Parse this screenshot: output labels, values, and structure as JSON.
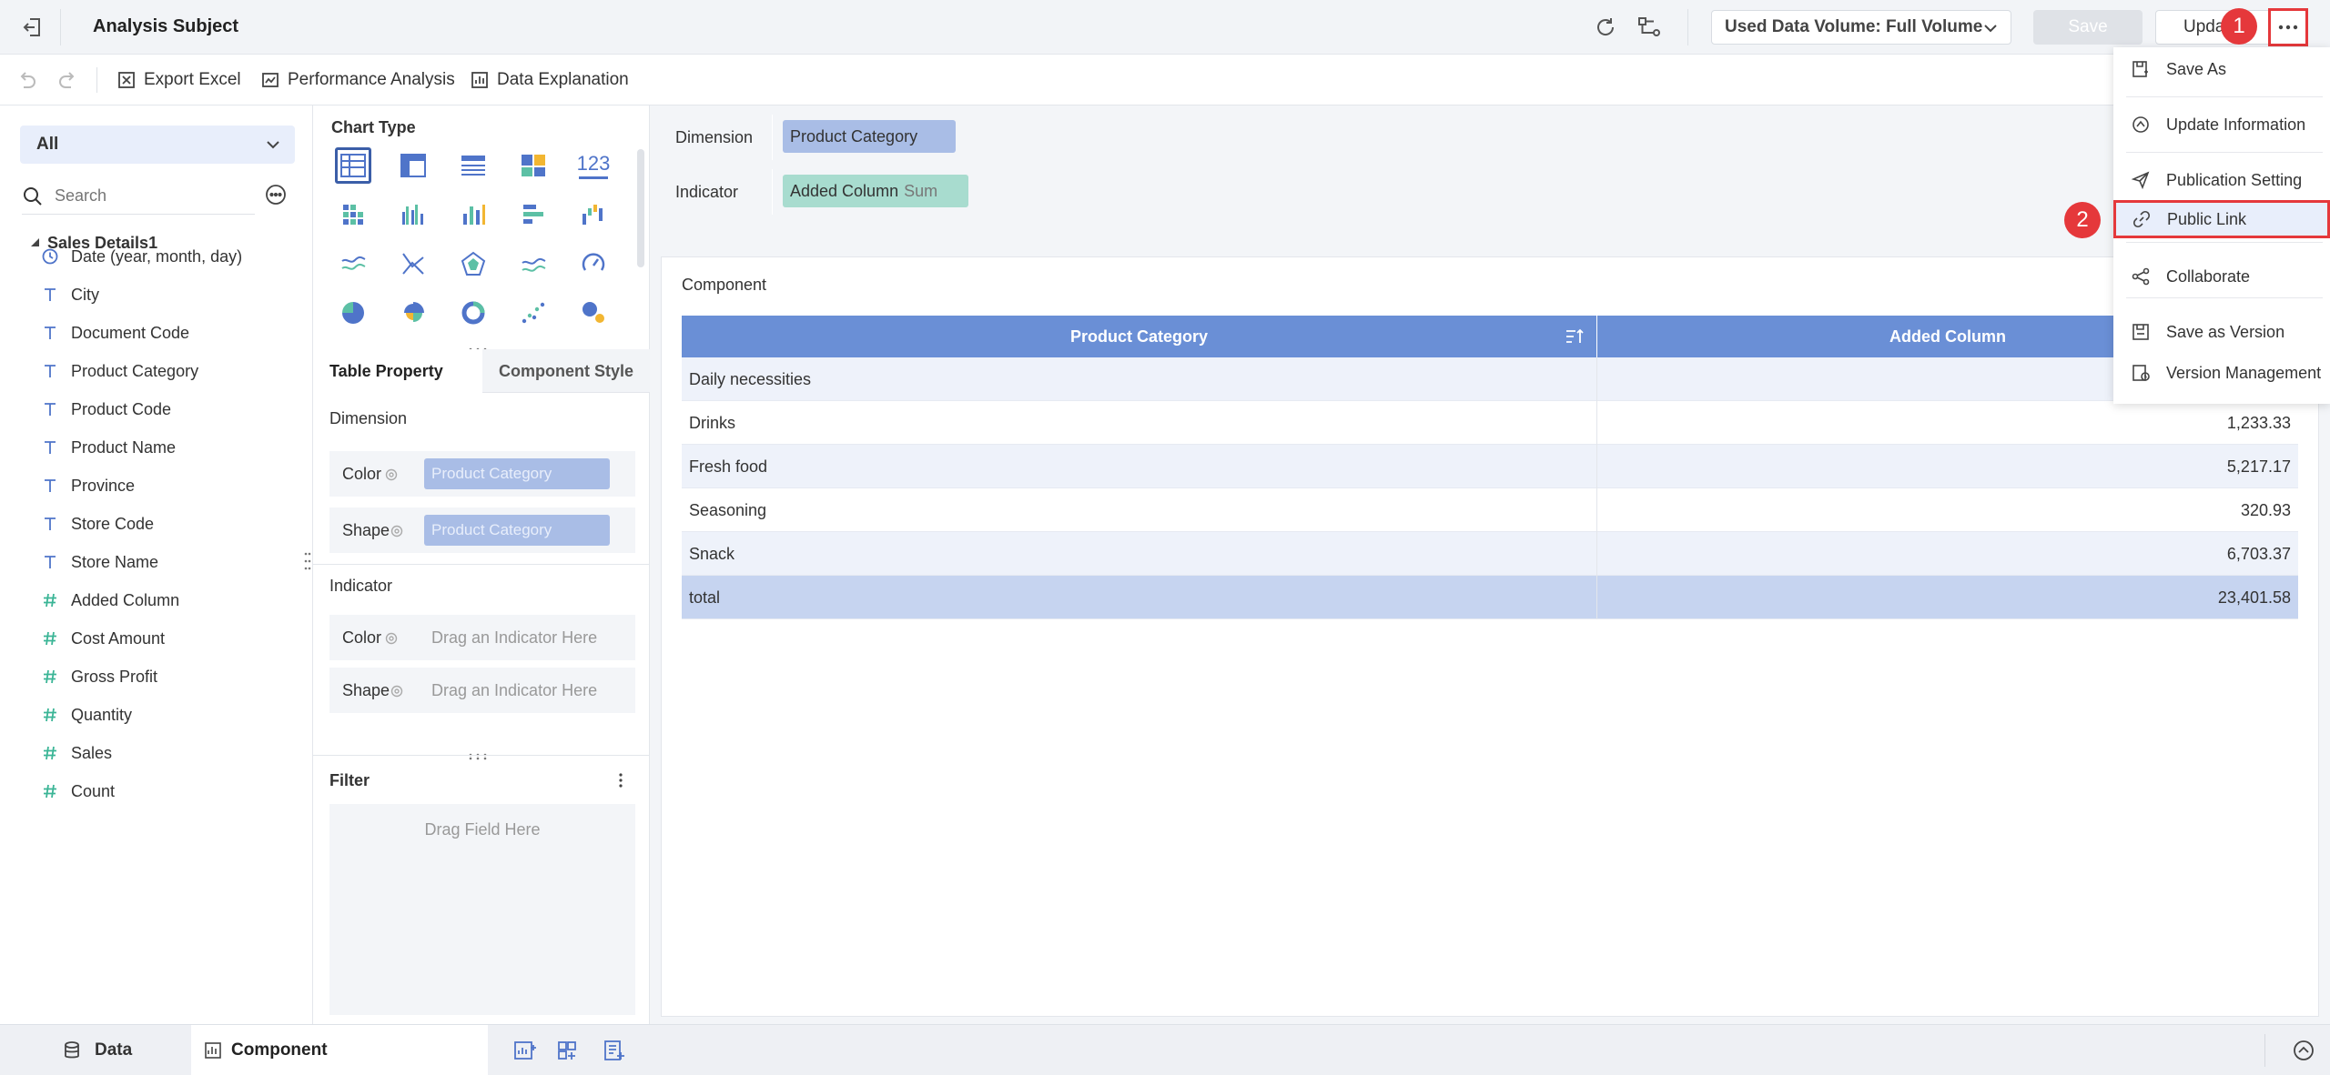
{
  "header": {
    "title": "Analysis Subject",
    "data_volume": "Used Data Volume: Full Volume",
    "save_label": "Save",
    "update_label": "Upda"
  },
  "toolbar": {
    "export_excel": "Export Excel",
    "performance_analysis": "Performance Analysis",
    "data_explanation": "Data Explanation"
  },
  "left": {
    "selector": "All",
    "search_placeholder": "Search",
    "dataset": "Sales Details1",
    "fields": [
      {
        "label": "Date (year, month, day)",
        "icon": "clock-icon"
      },
      {
        "label": "City",
        "icon": "text-type-icon"
      },
      {
        "label": "Document Code",
        "icon": "text-type-icon"
      },
      {
        "label": "Product Category",
        "icon": "text-type-icon"
      },
      {
        "label": "Product Code",
        "icon": "text-type-icon"
      },
      {
        "label": "Product Name",
        "icon": "text-type-icon"
      },
      {
        "label": "Province",
        "icon": "text-type-icon"
      },
      {
        "label": "Store Code",
        "icon": "text-type-icon"
      },
      {
        "label": "Store Name",
        "icon": "text-type-icon"
      },
      {
        "label": "Added Column",
        "icon": "number-type-icon"
      },
      {
        "label": "Cost Amount",
        "icon": "number-type-icon"
      },
      {
        "label": "Gross Profit",
        "icon": "number-type-icon"
      },
      {
        "label": "Quantity",
        "icon": "number-type-icon"
      },
      {
        "label": "Sales",
        "icon": "number-type-icon"
      },
      {
        "label": "Count",
        "icon": "number-type-icon"
      }
    ]
  },
  "middle": {
    "chart_type_title": "Chart Type",
    "number_card_label": "123",
    "tab_table_property": "Table Property",
    "tab_component_style": "Component Style",
    "dimension_title": "Dimension",
    "color_label": "Color",
    "shape_label": "Shape",
    "dim_color_value": "Product Category",
    "dim_shape_value": "Product Category",
    "indicator_title": "Indicator",
    "ind_color_placeholder": "Drag an Indicator Here",
    "ind_shape_placeholder": "Drag an Indicator Here",
    "filter_title": "Filter",
    "filter_drop": "Drag Field Here"
  },
  "right": {
    "dimension_label": "Dimension",
    "dimension_chip": "Product Category",
    "indicator_label": "Indicator",
    "indicator_chip": "Added Column",
    "indicator_agg": "Sum",
    "component_title": "Component",
    "table": {
      "headers": [
        "Product Category",
        "Added Column"
      ],
      "rows": [
        [
          "Daily necessities",
          ""
        ],
        [
          "Drinks",
          "1,233.33"
        ],
        [
          "Fresh food",
          "5,217.17"
        ],
        [
          "Seasoning",
          "320.93"
        ],
        [
          "Snack",
          "6,703.37"
        ]
      ],
      "total": [
        "total",
        "23,401.58"
      ]
    }
  },
  "menu": {
    "items": [
      {
        "label": "Save As",
        "icon": "save-as-icon"
      },
      {
        "label": "Update Information",
        "icon": "update-info-icon"
      },
      {
        "label": "Publication Setting",
        "icon": "send-icon"
      },
      {
        "label": "Public Link",
        "icon": "link-icon"
      },
      {
        "label": "Collaborate",
        "icon": "share-icon"
      },
      {
        "label": "Save as Version",
        "icon": "save-version-icon"
      },
      {
        "label": "Version Management",
        "icon": "version-manage-icon"
      }
    ]
  },
  "bottom": {
    "data_tab": "Data",
    "component_tab": "Component"
  },
  "annotations": {
    "step1": "1",
    "step2": "2"
  },
  "colors": {
    "accent": "#6a8fd6",
    "dim_chip": "#a9bde6",
    "ind_chip": "#a8dccf",
    "highlight": "#e5383b"
  }
}
